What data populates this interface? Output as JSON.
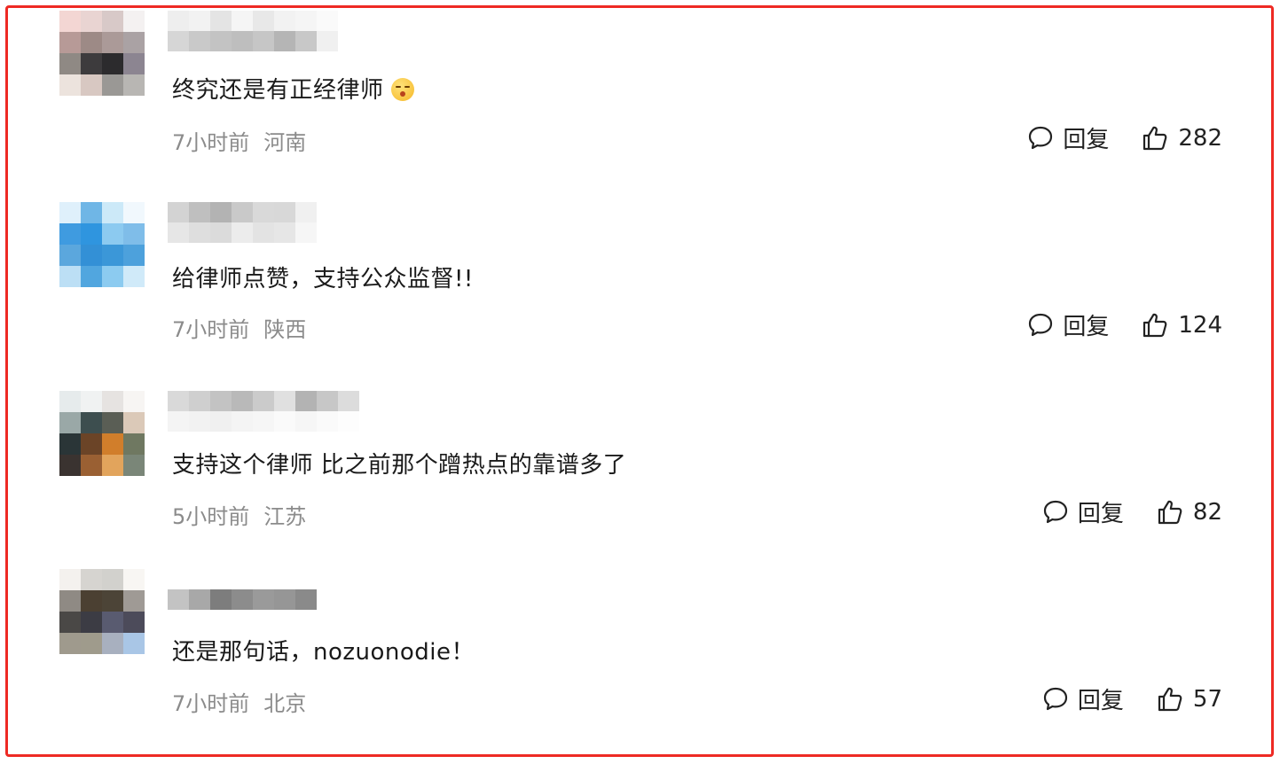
{
  "labels": {
    "reply": "回复"
  },
  "colors": {
    "frame": "#ee2a24",
    "meta_text": "#8b8b8b",
    "body_text": "#1a1a1a"
  },
  "comments": [
    {
      "text": "终究还是有正经律师",
      "emoji": "flushed-face-emoji",
      "time": "7小时前",
      "location": "河南",
      "likes": "282"
    },
    {
      "text": "给律师点赞，支持公众监督!!",
      "time": "7小时前",
      "location": "陕西",
      "likes": "124"
    },
    {
      "text": "支持这个律师 比之前那个蹭热点的靠谱多了",
      "time": "5小时前",
      "location": "江苏",
      "likes": "82"
    },
    {
      "text": "还是那句话，nozuonodie！",
      "time": "7小时前",
      "location": "北京",
      "likes": "57"
    }
  ],
  "avatar_palettes": [
    [
      "#f3d6d3",
      "#e9d4d2",
      "#d8c9c8",
      "#f4f1f1",
      "#b79a97",
      "#9d8a86",
      "#ab9a98",
      "#aaa2a4",
      "#8f8984",
      "#3d3b3d",
      "#2c2b2d",
      "#8c8591",
      "#ece3dd",
      "#d8c8c2",
      "#9a9895",
      "#b8b6b3"
    ],
    [
      "#dff0fb",
      "#6fb6e6",
      "#cce9f8",
      "#f1f8fd",
      "#3f9be0",
      "#2f95df",
      "#8ccaf0",
      "#7fbde9",
      "#5ba7dd",
      "#3390d6",
      "#3b97d8",
      "#4da1dc",
      "#bcdff5",
      "#51a6df",
      "#8ccbf0",
      "#d0eaf9"
    ],
    [
      "#e6ebec",
      "#f0f2f2",
      "#e6e3e1",
      "#f7f5f3",
      "#9aa8a7",
      "#3d4e4f",
      "#5a5e55",
      "#dbc9b8",
      "#2a3537",
      "#6b4427",
      "#d17e2b",
      "#6f7861",
      "#3a3330",
      "#9a6033",
      "#e2a45c",
      "#7a8678"
    ],
    [
      "#f4f1ee",
      "#d6d4d0",
      "#d2d1cd",
      "#f8f6f3",
      "#8f8a84",
      "#4b4032",
      "#4c4437",
      "#9f9a95",
      "#4a4846",
      "#3c3c44",
      "#595b70",
      "#4c4b5a",
      "#9f9a8d",
      "#9f9b8c",
      "#a8b0bf",
      "#a9c6e6"
    ]
  ],
  "name_palettes": [
    [
      [
        "#eeeeee",
        "#f2f2f2",
        "#e4e4e4",
        "#f5f5f5",
        "#e8e8e8",
        "#f2f2f2",
        "#f5f5f5",
        "#fafafa"
      ],
      [
        "#d6d6d6",
        "#c9c9c9",
        "#c3c3c3",
        "#bebebe",
        "#c6c6c6",
        "#b5b5b5",
        "#c8c8c8",
        "#f0f0f0"
      ]
    ],
    [
      [
        "#d3d3d3",
        "#bfbfbf",
        "#b3b3b3",
        "#c9c9c9",
        "#d9d9d9",
        "#d8d8d8",
        "#f0f0f0"
      ],
      [
        "#e6e6e6",
        "#dedede",
        "#dbdbdb",
        "#ececec",
        "#e3e3e3",
        "#e6e6e6",
        "#f6f6f6"
      ]
    ],
    [
      [
        "#d9d9d9",
        "#cfcfcf",
        "#c3c3c3",
        "#b9b9b9",
        "#cbcbcb",
        "#e0e0e0",
        "#b3b3b3",
        "#c7c7c7",
        "#dcdcdc"
      ],
      [
        "#f4f4f4",
        "#f2f2f2",
        "#f0f0f0",
        "#f4f4f4",
        "#f6f6f6",
        "#fafafa",
        "#f6f6f6",
        "#fafafa",
        "#fdfdfd"
      ]
    ],
    [
      [
        "#ffffff",
        "#ffffff",
        "#ffffff",
        "#ffffff",
        "#ffffff",
        "#ffffff",
        "#ffffff"
      ],
      [
        "#c3c3c3",
        "#a8a8a8",
        "#7d7d7d",
        "#8c8c8c",
        "#9a9a9a",
        "#969696",
        "#8a8a8a"
      ]
    ]
  ]
}
